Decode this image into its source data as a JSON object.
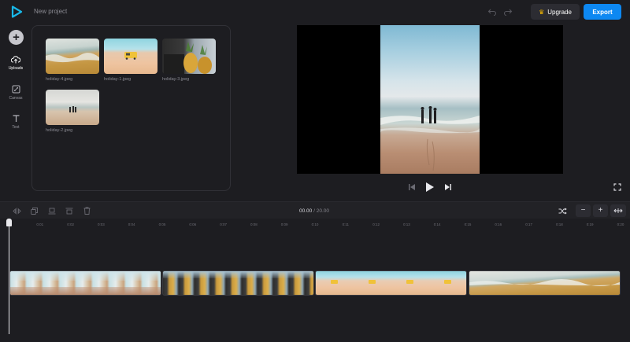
{
  "app": {
    "project_title": "New project",
    "upgrade_label": "Upgrade",
    "export_label": "Export",
    "accent": "#0d88f2",
    "logo_icon": "play-logo-icon"
  },
  "rail": [
    {
      "label": "Uploads",
      "icon": "upload-cloud-icon",
      "active": true
    },
    {
      "label": "Canvas",
      "icon": "canvas-resize-icon",
      "active": false
    },
    {
      "label": "Text",
      "icon": "text-icon",
      "active": false
    }
  ],
  "media": [
    {
      "name": "holiday-4.jpeg"
    },
    {
      "name": "holiday-1.jpeg"
    },
    {
      "name": "holiday-3.jpeg"
    },
    {
      "name": "holiday-2.jpeg"
    }
  ],
  "timeline": {
    "current_time": "00.00",
    "separator": "/",
    "total_time": "20.00",
    "ticks": [
      "0",
      "0:01",
      "0:02",
      "0:03",
      "0:04",
      "0:05",
      "0:06",
      "0:07",
      "0:08",
      "0:09",
      "0:10",
      "0:11",
      "0:12",
      "0:13",
      "0:14",
      "0:15",
      "0:16",
      "0:17",
      "0:18",
      "0:19",
      "0:20"
    ]
  }
}
